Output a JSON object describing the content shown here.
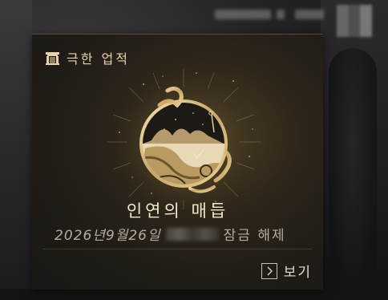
{
  "card": {
    "title": "극한 업적",
    "achievement_name": "인연의 매듭",
    "unlock_date": "2026년9월26일",
    "unlock_label": "잠금 해제",
    "view_label": "보기"
  },
  "icons": {
    "header": "gate-icon",
    "emblem": "knot-emblem-icon",
    "view": "chevron-right-icon"
  },
  "colors": {
    "accent_gold": "#e6d2a4",
    "name_text": "#f3e8cc",
    "sub_text": "#b4ab9a",
    "panel_bg": "#2d261a"
  }
}
